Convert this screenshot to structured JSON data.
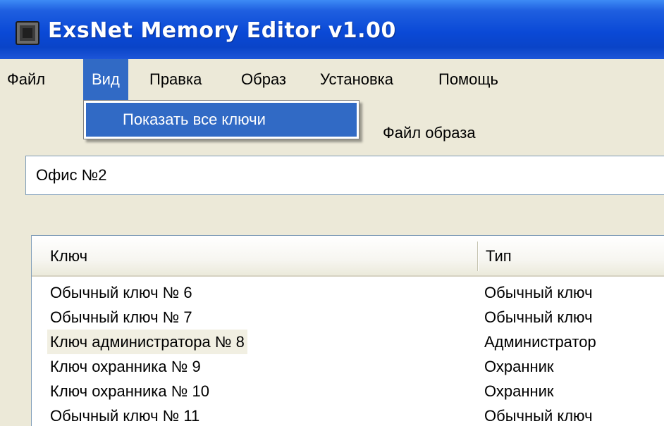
{
  "window": {
    "title": "ExsNet Memory Editor v1.00",
    "icon": "memory-chip-icon"
  },
  "menu": {
    "items": [
      "Файл",
      "Вид",
      "Правка",
      "Образ",
      "Установка",
      "Помощь"
    ],
    "active": "Вид",
    "dropdown": {
      "items": [
        "Показать все ключи"
      ]
    }
  },
  "image_file": {
    "label": "Файл образа",
    "value": "Офис №2"
  },
  "key_list": {
    "columns": [
      "Ключ",
      "Тип"
    ],
    "rows": [
      {
        "key": "Обычный ключ № 6",
        "type": "Обычный ключ"
      },
      {
        "key": "Обычный ключ № 7",
        "type": "Обычный ключ"
      },
      {
        "key": "Ключ администратора № 8",
        "type": "Администратор"
      },
      {
        "key": "Ключ охранника № 9",
        "type": "Охранник"
      },
      {
        "key": "Ключ охранника № 10",
        "type": "Охранник"
      },
      {
        "key": "Обычный ключ № 11",
        "type": "Обычный ключ"
      }
    ],
    "selected_row": 2
  },
  "colors": {
    "titlebar": "#0a49d6",
    "menu_highlight": "#316ac5",
    "face": "#ece9d8"
  }
}
